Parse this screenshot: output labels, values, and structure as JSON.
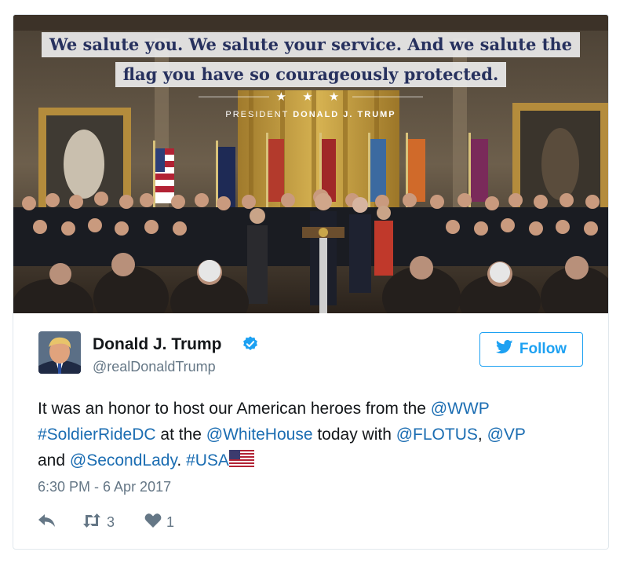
{
  "image_card": {
    "quote_line_1": "We salute you. We salute your service. And we salute the",
    "quote_line_2": "flag you have so courageously protected.",
    "stars": "★ ★ ★",
    "byline_prefix": "PRESIDENT",
    "byline_name": "DONALD J. TRUMP"
  },
  "author": {
    "name": "Donald J. Trump",
    "handle": "@realDonaldTrump",
    "verified_icon": "verified-badge-icon"
  },
  "follow_button": {
    "label": "Follow",
    "icon": "bird-icon"
  },
  "tweet": {
    "t1": "It was an honor to host our American heroes from the ",
    "m_wwp": "@WWP",
    "t2": " ",
    "h_soldier": "#SoldierRideDC",
    "t3": " at the ",
    "m_whitehouse": "@WhiteHouse",
    "t4": " today with ",
    "m_flotus": "@FLOTUS",
    "t5": ", ",
    "m_vp": "@VP",
    "t6": " and ",
    "m_secondlady": "@SecondLady",
    "t7": ". ",
    "h_usa": "#USA"
  },
  "timestamp": "6:30 PM - 6 Apr 2017",
  "actions": {
    "reply_icon": "reply-icon",
    "retweet_icon": "retweet-icon",
    "retweet_count": "3",
    "like_icon": "heart-icon",
    "like_count": "1"
  },
  "colors": {
    "link": "#1b6db2",
    "accent": "#1da1f2",
    "muted": "#657786",
    "text": "#14171a",
    "quote_text": "#27315e"
  }
}
